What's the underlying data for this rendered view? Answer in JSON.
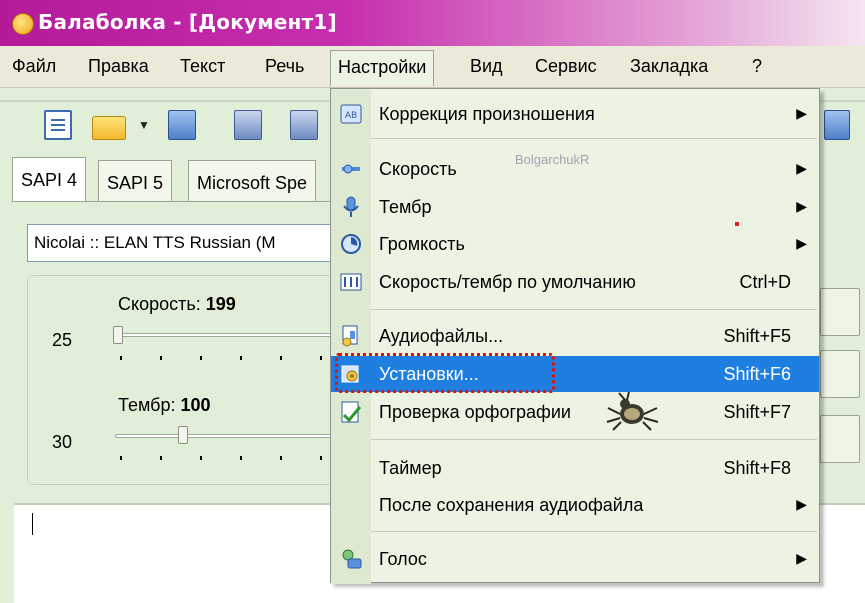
{
  "window": {
    "title": "Балаболка - [Документ1]"
  },
  "menubar": {
    "items": [
      "Файл",
      "Правка",
      "Текст",
      "Речь",
      "Настройки",
      "Вид",
      "Сервис",
      "Закладка",
      "?"
    ]
  },
  "tabs": [
    "SAPI 4",
    "SAPI 5",
    "Microsoft Spe"
  ],
  "voice": {
    "selected": "Nicolai :: ELAN TTS Russian (M"
  },
  "sliders": {
    "speed": {
      "label": "Скорость:",
      "value": "199",
      "min": "25"
    },
    "pitch": {
      "label": "Тембр:",
      "value": "100",
      "min": "30"
    }
  },
  "settings_menu": {
    "items": [
      {
        "label": "Коррекция произношения",
        "shortcut": "",
        "submenu": true,
        "icon": "pronunciation-icon"
      },
      {
        "label": "Скорость",
        "shortcut": "",
        "submenu": true,
        "icon": "speed-icon"
      },
      {
        "label": "Тембр",
        "shortcut": "",
        "submenu": true,
        "icon": "microphone-icon"
      },
      {
        "label": "Громкость",
        "shortcut": "",
        "submenu": true,
        "icon": "volume-icon"
      },
      {
        "label": "Скорость/тембр по умолчанию",
        "shortcut": "Ctrl+D",
        "submenu": false,
        "icon": "sliders-icon"
      },
      {
        "label": "Аудиофайлы...",
        "shortcut": "Shift+F5",
        "submenu": false,
        "icon": "audio-files-icon"
      },
      {
        "label": "Установки...",
        "shortcut": "Shift+F6",
        "submenu": false,
        "icon": "settings-icon",
        "highlighted": true
      },
      {
        "label": "Проверка орфографии",
        "shortcut": "Shift+F7",
        "submenu": false,
        "icon": "spellcheck-icon"
      },
      {
        "label": "Таймер",
        "shortcut": "Shift+F8",
        "submenu": false,
        "icon": ""
      },
      {
        "label": "После сохранения аудиофайла",
        "shortcut": "",
        "submenu": true,
        "icon": ""
      },
      {
        "label": "Голос",
        "shortcut": "",
        "submenu": true,
        "icon": "voice-icon"
      }
    ]
  },
  "watermark": "BolgarchukR",
  "colors": {
    "title_bar": "#b41a9a",
    "highlight": "#1e7fe0",
    "menu_bg": "#ecf3e3",
    "app_bg": "#e2efd8",
    "annotation": "#e01010"
  }
}
